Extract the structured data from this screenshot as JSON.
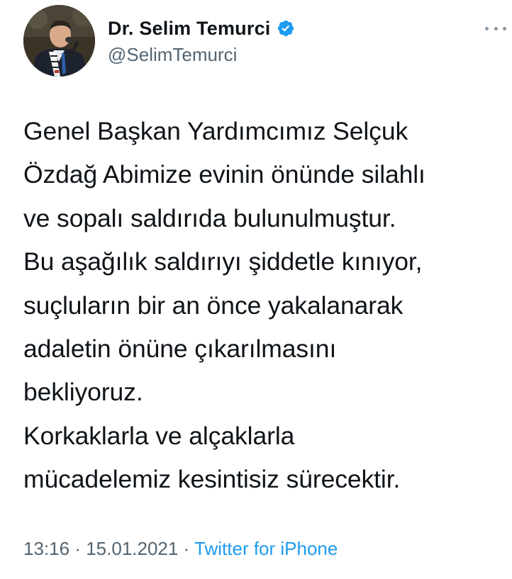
{
  "author": {
    "display_name": "Dr. Selim Temurci",
    "handle": "@SelimTemurci",
    "verified": true,
    "avatar_icon": "profile-photo"
  },
  "menu_icon": "more-horizontal-icon",
  "tweet": {
    "lines": [
      "Genel Başkan Yardımcımız Selçuk",
      "Özdağ Abimize evinin önünde silahlı",
      "ve sopalı saldırıda bulunulmuştur.",
      "Bu aşağılık saldırıyı şiddetle kınıyor,",
      "suçluların bir an önce yakalanarak",
      "adaletin önüne çıkarılmasını",
      "bekliyoruz.",
      "Korkaklarla ve alçaklarla",
      "mücadelemiz kesintisiz sürecektir."
    ]
  },
  "meta": {
    "time": "13:16",
    "separator": "·",
    "date": "15.01.2021",
    "source": "Twitter for iPhone"
  },
  "colors": {
    "text": "#0f1419",
    "secondary": "#536471",
    "link": "#1d9bf0",
    "verified_badge": "#1d9bf0"
  }
}
